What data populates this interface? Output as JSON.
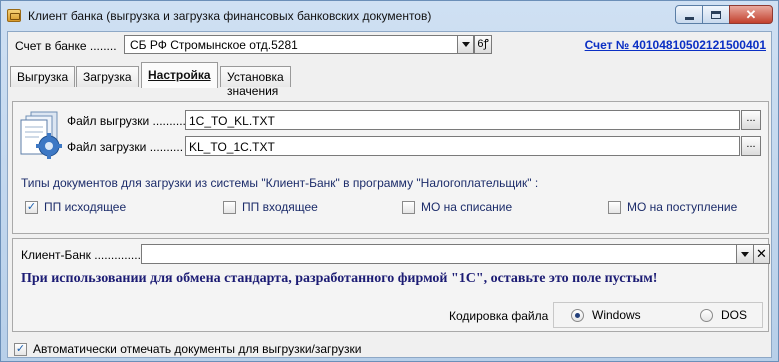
{
  "window": {
    "title": "Клиент банка (выгрузка и загрузка финансовых банковских документов)",
    "close_glyph": "✕"
  },
  "account": {
    "label": "Счет в банке ........",
    "selected": "СБ РФ Стромынское отд.5281",
    "picker_glyph": "6ꝭ",
    "link": "Счет № 40104810502121500401"
  },
  "tabs": [
    {
      "label": "Выгрузка"
    },
    {
      "label": "Загрузка"
    },
    {
      "label": "Настройка"
    },
    {
      "label": "Установка значения операции при загрузке"
    }
  ],
  "active_tab": "Настройка",
  "files": {
    "export_label": "Файл выгрузки ..........",
    "export_value": "1C_TO_KL.TXT",
    "import_label": "Файл загрузки ..........",
    "import_value": "KL_TO_1C.TXT",
    "browse_glyph": "..."
  },
  "doc_types": {
    "caption": "Типы документов для загрузки из системы \"Клиент-Банк\" в программу \"Налогоплательщик\" :",
    "items": [
      {
        "label": "ПП исходящее",
        "checked": true
      },
      {
        "label": "ПП входящее",
        "checked": false
      },
      {
        "label": "МО на списание",
        "checked": false
      },
      {
        "label": "МО на поступление",
        "checked": false
      }
    ]
  },
  "client_bank": {
    "label": "Клиент-Банк ..............",
    "value": "",
    "clear_glyph": "✕",
    "note": "При использовании для обмена стандарта, разработанного фирмой \"1С\",  оставьте это поле пустым!"
  },
  "encoding": {
    "label": "Кодировка файла",
    "options": [
      {
        "label": "Windows",
        "selected": true
      },
      {
        "label": "DOS",
        "selected": false
      }
    ]
  },
  "auto_mark": {
    "label": "Автоматически отмечать документы для выгрузки/загрузки",
    "checked": true
  },
  "check_glyph": "✓"
}
